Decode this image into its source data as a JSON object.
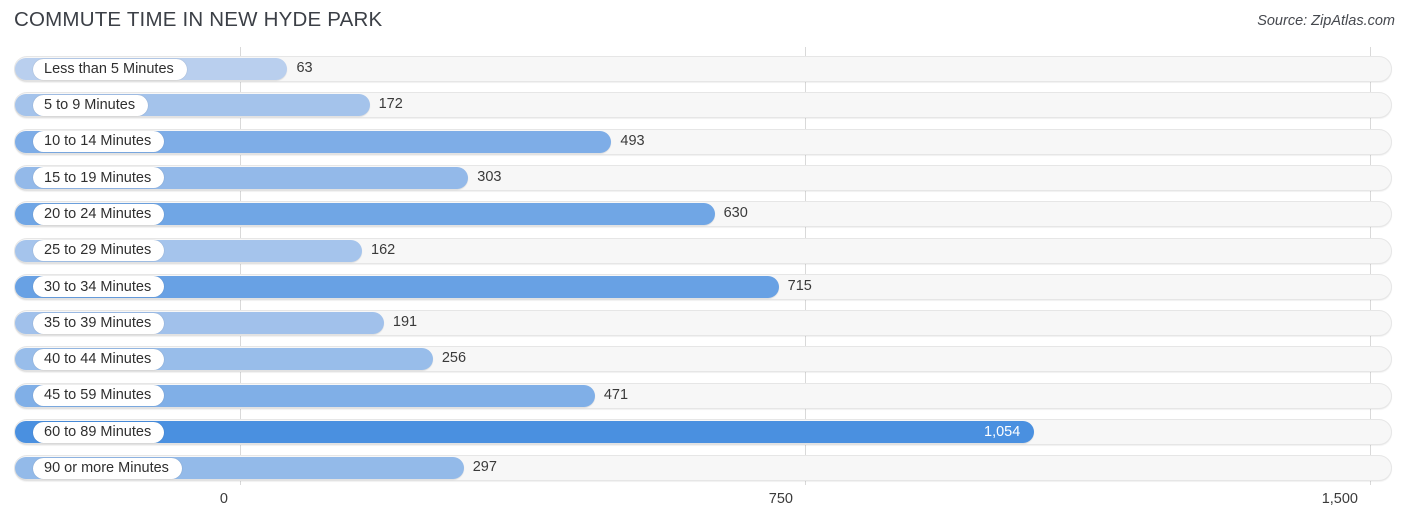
{
  "header": {
    "title": "COMMUTE TIME IN NEW HYDE PARK",
    "source": "Source: ZipAtlas.com"
  },
  "axis": {
    "ticks": [
      "0",
      "750",
      "1,500"
    ],
    "tick_values": [
      0,
      750,
      1500
    ]
  },
  "colors": {
    "bar_min": "#b9cfee",
    "bar_max": "#4a90e0",
    "track_fill": "#f7f7f7",
    "track_border": "#e6e6e6",
    "gridline": "#d9d9d9",
    "title_text": "#3b3f46",
    "value_text": "#3a3a3a",
    "value_text_inside": "#ffffff"
  },
  "chart_data": {
    "type": "bar",
    "orientation": "horizontal",
    "title": "COMMUTE TIME IN NEW HYDE PARK",
    "xlabel": "",
    "ylabel": "",
    "xlim": [
      0,
      1500
    ],
    "grid": true,
    "legend": "none",
    "source": "Source: ZipAtlas.com",
    "categories": [
      "Less than 5 Minutes",
      "5 to 9 Minutes",
      "10 to 14 Minutes",
      "15 to 19 Minutes",
      "20 to 24 Minutes",
      "25 to 29 Minutes",
      "30 to 34 Minutes",
      "35 to 39 Minutes",
      "40 to 44 Minutes",
      "45 to 59 Minutes",
      "60 to 89 Minutes",
      "90 or more Minutes"
    ],
    "values": [
      63,
      172,
      493,
      303,
      630,
      162,
      715,
      191,
      256,
      471,
      1054,
      297
    ],
    "value_labels": [
      "63",
      "172",
      "493",
      "303",
      "630",
      "162",
      "715",
      "191",
      "256",
      "471",
      "1,054",
      "297"
    ]
  }
}
